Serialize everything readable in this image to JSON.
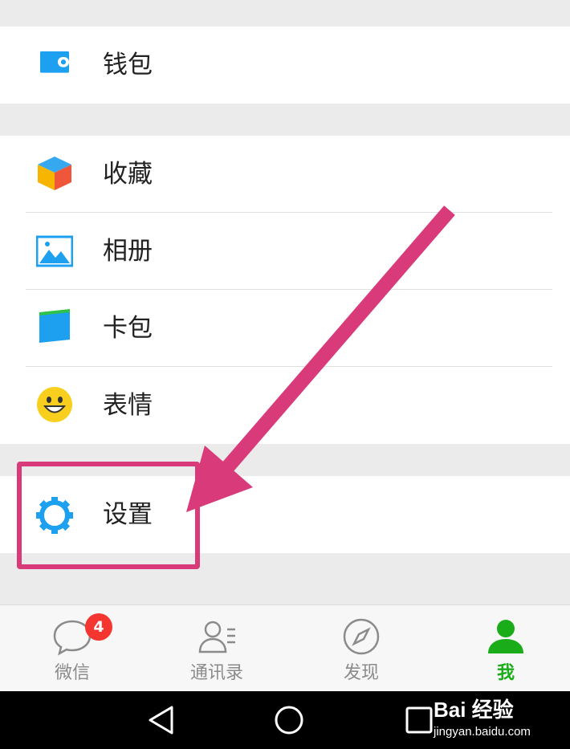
{
  "menu": {
    "wallet": {
      "label": "钱包",
      "icon": "wallet-icon"
    },
    "favorites": {
      "label": "收藏",
      "icon": "cube-icon"
    },
    "album": {
      "label": "相册",
      "icon": "picture-icon"
    },
    "cards": {
      "label": "卡包",
      "icon": "card-icon"
    },
    "stickers": {
      "label": "表情",
      "icon": "smiley-icon"
    },
    "settings": {
      "label": "设置",
      "icon": "gear-icon"
    }
  },
  "tabbar": {
    "tabs": [
      {
        "label": "微信",
        "icon": "chat-bubble-icon",
        "badge": "4"
      },
      {
        "label": "通讯录",
        "icon": "contacts-icon"
      },
      {
        "label": "发现",
        "icon": "compass-icon"
      },
      {
        "label": "我",
        "icon": "person-icon",
        "active": true
      }
    ]
  },
  "watermark": {
    "main": "Bai 经验",
    "sub": "jingyan.baidu.com"
  },
  "colors": {
    "accent": "#1aad19",
    "badge": "#f43530",
    "annotation": "#d93a7a",
    "icon_blue": "#1ea0f0"
  }
}
